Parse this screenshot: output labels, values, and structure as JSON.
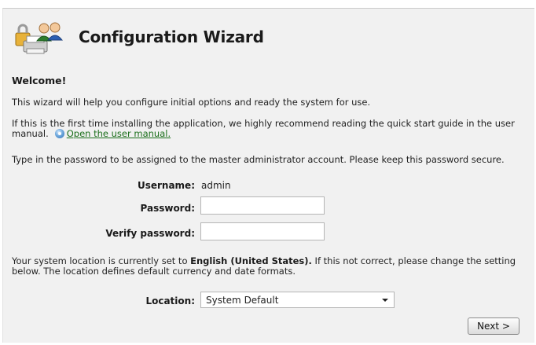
{
  "header": {
    "title": "Configuration Wizard",
    "icon": "lock-users-printer-icon"
  },
  "welcome": "Welcome!",
  "intro": "This wizard will help you configure initial options and ready the system for use.",
  "manual": {
    "text": "If this is the first time installing the application, we highly recommend reading the quick start guide in the user manual.",
    "link_label": "Open the user manual.",
    "icon": "help-icon"
  },
  "password_note": "Type in the password to be assigned to the master administrator account. Please keep this password secure.",
  "form": {
    "username_label": "Username:",
    "username_value": "admin",
    "password_label": "Password:",
    "password_value": "",
    "verify_label": "Verify password:",
    "verify_value": ""
  },
  "location_note": {
    "prefix": "Your system location is currently set to ",
    "current": "English (United States).",
    "suffix": " If this not correct, please change the setting below. The location defines default currency and date formats."
  },
  "location": {
    "label": "Location:",
    "selected": "System Default"
  },
  "next_label": "Next >",
  "colors": {
    "panel": "#f1f1f1",
    "link": "#1a6e1a",
    "text": "#222222"
  }
}
